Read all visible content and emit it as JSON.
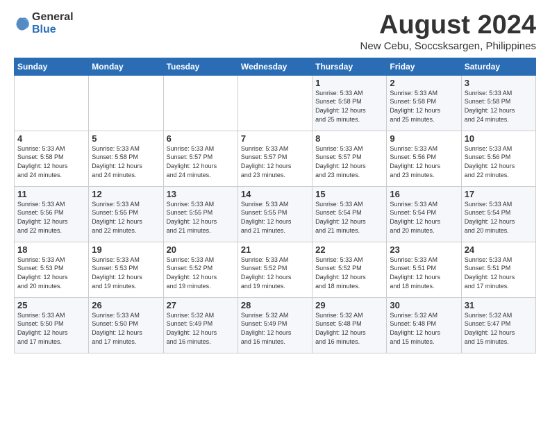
{
  "logo": {
    "general": "General",
    "blue": "Blue"
  },
  "title": "August 2024",
  "subtitle": "New Cebu, Soccsksargen, Philippines",
  "headers": [
    "Sunday",
    "Monday",
    "Tuesday",
    "Wednesday",
    "Thursday",
    "Friday",
    "Saturday"
  ],
  "weeks": [
    [
      {
        "day": "",
        "info": ""
      },
      {
        "day": "",
        "info": ""
      },
      {
        "day": "",
        "info": ""
      },
      {
        "day": "",
        "info": ""
      },
      {
        "day": "1",
        "info": "Sunrise: 5:33 AM\nSunset: 5:58 PM\nDaylight: 12 hours\nand 25 minutes."
      },
      {
        "day": "2",
        "info": "Sunrise: 5:33 AM\nSunset: 5:58 PM\nDaylight: 12 hours\nand 25 minutes."
      },
      {
        "day": "3",
        "info": "Sunrise: 5:33 AM\nSunset: 5:58 PM\nDaylight: 12 hours\nand 24 minutes."
      }
    ],
    [
      {
        "day": "4",
        "info": "Sunrise: 5:33 AM\nSunset: 5:58 PM\nDaylight: 12 hours\nand 24 minutes."
      },
      {
        "day": "5",
        "info": "Sunrise: 5:33 AM\nSunset: 5:58 PM\nDaylight: 12 hours\nand 24 minutes."
      },
      {
        "day": "6",
        "info": "Sunrise: 5:33 AM\nSunset: 5:57 PM\nDaylight: 12 hours\nand 24 minutes."
      },
      {
        "day": "7",
        "info": "Sunrise: 5:33 AM\nSunset: 5:57 PM\nDaylight: 12 hours\nand 23 minutes."
      },
      {
        "day": "8",
        "info": "Sunrise: 5:33 AM\nSunset: 5:57 PM\nDaylight: 12 hours\nand 23 minutes."
      },
      {
        "day": "9",
        "info": "Sunrise: 5:33 AM\nSunset: 5:56 PM\nDaylight: 12 hours\nand 23 minutes."
      },
      {
        "day": "10",
        "info": "Sunrise: 5:33 AM\nSunset: 5:56 PM\nDaylight: 12 hours\nand 22 minutes."
      }
    ],
    [
      {
        "day": "11",
        "info": "Sunrise: 5:33 AM\nSunset: 5:56 PM\nDaylight: 12 hours\nand 22 minutes."
      },
      {
        "day": "12",
        "info": "Sunrise: 5:33 AM\nSunset: 5:55 PM\nDaylight: 12 hours\nand 22 minutes."
      },
      {
        "day": "13",
        "info": "Sunrise: 5:33 AM\nSunset: 5:55 PM\nDaylight: 12 hours\nand 21 minutes."
      },
      {
        "day": "14",
        "info": "Sunrise: 5:33 AM\nSunset: 5:55 PM\nDaylight: 12 hours\nand 21 minutes."
      },
      {
        "day": "15",
        "info": "Sunrise: 5:33 AM\nSunset: 5:54 PM\nDaylight: 12 hours\nand 21 minutes."
      },
      {
        "day": "16",
        "info": "Sunrise: 5:33 AM\nSunset: 5:54 PM\nDaylight: 12 hours\nand 20 minutes."
      },
      {
        "day": "17",
        "info": "Sunrise: 5:33 AM\nSunset: 5:54 PM\nDaylight: 12 hours\nand 20 minutes."
      }
    ],
    [
      {
        "day": "18",
        "info": "Sunrise: 5:33 AM\nSunset: 5:53 PM\nDaylight: 12 hours\nand 20 minutes."
      },
      {
        "day": "19",
        "info": "Sunrise: 5:33 AM\nSunset: 5:53 PM\nDaylight: 12 hours\nand 19 minutes."
      },
      {
        "day": "20",
        "info": "Sunrise: 5:33 AM\nSunset: 5:52 PM\nDaylight: 12 hours\nand 19 minutes."
      },
      {
        "day": "21",
        "info": "Sunrise: 5:33 AM\nSunset: 5:52 PM\nDaylight: 12 hours\nand 19 minutes."
      },
      {
        "day": "22",
        "info": "Sunrise: 5:33 AM\nSunset: 5:52 PM\nDaylight: 12 hours\nand 18 minutes."
      },
      {
        "day": "23",
        "info": "Sunrise: 5:33 AM\nSunset: 5:51 PM\nDaylight: 12 hours\nand 18 minutes."
      },
      {
        "day": "24",
        "info": "Sunrise: 5:33 AM\nSunset: 5:51 PM\nDaylight: 12 hours\nand 17 minutes."
      }
    ],
    [
      {
        "day": "25",
        "info": "Sunrise: 5:33 AM\nSunset: 5:50 PM\nDaylight: 12 hours\nand 17 minutes."
      },
      {
        "day": "26",
        "info": "Sunrise: 5:33 AM\nSunset: 5:50 PM\nDaylight: 12 hours\nand 17 minutes."
      },
      {
        "day": "27",
        "info": "Sunrise: 5:32 AM\nSunset: 5:49 PM\nDaylight: 12 hours\nand 16 minutes."
      },
      {
        "day": "28",
        "info": "Sunrise: 5:32 AM\nSunset: 5:49 PM\nDaylight: 12 hours\nand 16 minutes."
      },
      {
        "day": "29",
        "info": "Sunrise: 5:32 AM\nSunset: 5:48 PM\nDaylight: 12 hours\nand 16 minutes."
      },
      {
        "day": "30",
        "info": "Sunrise: 5:32 AM\nSunset: 5:48 PM\nDaylight: 12 hours\nand 15 minutes."
      },
      {
        "day": "31",
        "info": "Sunrise: 5:32 AM\nSunset: 5:47 PM\nDaylight: 12 hours\nand 15 minutes."
      }
    ]
  ]
}
